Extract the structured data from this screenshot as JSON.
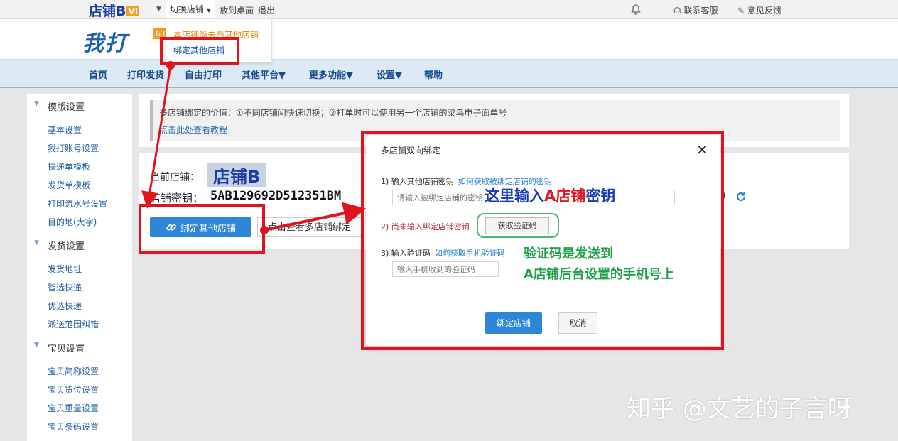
{
  "topbar": {
    "store_name": "店铺B",
    "store_badge": "VI",
    "switch_store": "切换店铺",
    "put_desktop": "放到桌面",
    "logout": "退出",
    "contact": "联系客服",
    "feedback": "意见反馈"
  },
  "header": {
    "logo": "我打",
    "version": "6.0"
  },
  "dropdown": {
    "item1": "本店铺尚未与其他店铺",
    "item2": "绑定其他店铺"
  },
  "nav": [
    "首页",
    "打印发货",
    "自由打印",
    "其他平台▼",
    "更多功能▼",
    "设置▼",
    "帮助"
  ],
  "sidebar": {
    "sections": [
      {
        "title": "模版设置",
        "items": [
          "基本设置",
          "我打账号设置",
          "快递单模板",
          "发货单模板",
          "打印流水号设置",
          "目的地(大字)"
        ]
      },
      {
        "title": "发货设置",
        "items": [
          "发货地址",
          "智选快递",
          "优选快递",
          "派送范围纠错"
        ]
      },
      {
        "title": "宝贝设置",
        "items": [
          "宝贝简称设置",
          "宝贝货位设置",
          "宝贝重量设置",
          "宝贝条码设置"
        ]
      }
    ]
  },
  "info": {
    "text": "多店铺绑定的价值：①不同店铺间快速切换；②打单时可以使用另一个店铺的菜鸟电子面单号",
    "link": "点击此处查看教程"
  },
  "main": {
    "current_label": "当前店铺：",
    "current_value": "店铺B",
    "key_label": "店铺密钥：",
    "key_value": "5AB129692D512351BM",
    "key_tail": ")",
    "bind_button": "绑定其他店铺",
    "view_button": "点击查看多店铺绑定"
  },
  "modal": {
    "title": "多店铺双向绑定",
    "step1_label": "1) 输入其他店铺密钥",
    "step1_link": "如何获取被绑定店铺的密钥",
    "key_placeholder": "请输入被绑定店铺的密钥",
    "step2_label": "2) 尚未输入绑定店铺密钥",
    "get_code_button": "获取验证码",
    "step3_label": "3) 输入验证码",
    "step3_link": "如何获取手机验证码",
    "code_placeholder": "输入手机收到的验证码",
    "confirm_button": "绑定店铺",
    "cancel_button": "取消"
  },
  "annotations": {
    "key_hint_a": "这里输入",
    "key_hint_b": "A店铺",
    "key_hint_c": "密钥",
    "code_hint_1": "验证码是发送到",
    "code_hint_2": "A店铺后台设置的手机号上"
  },
  "watermark": "知乎 @文艺的子言呀"
}
